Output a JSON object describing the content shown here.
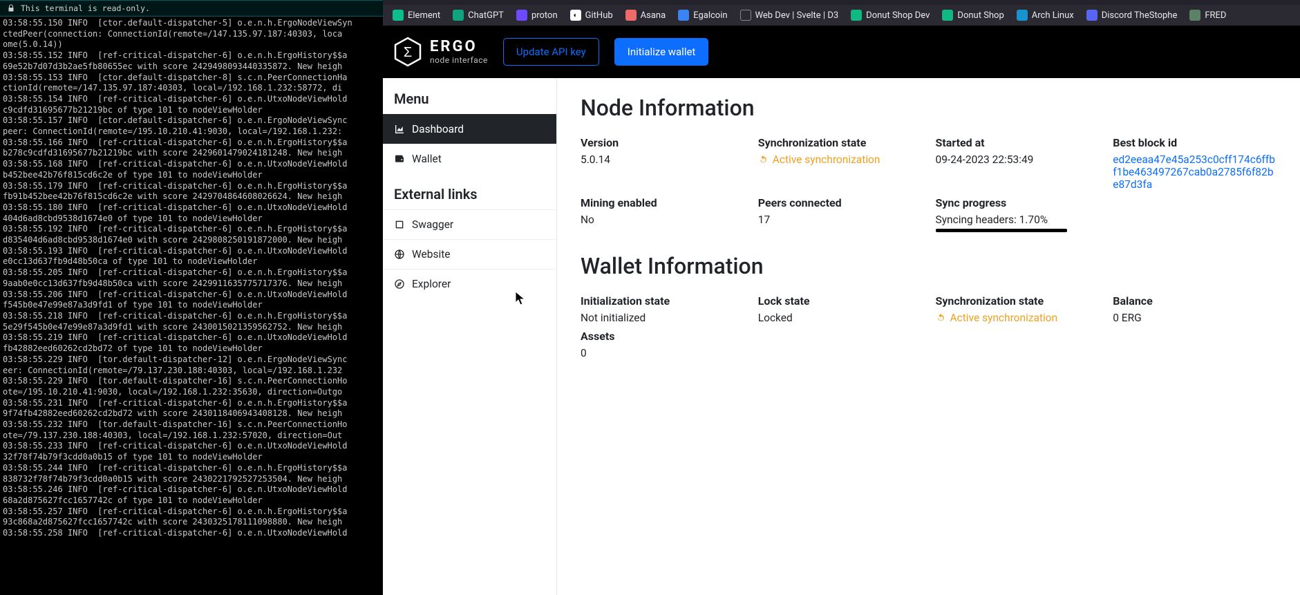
{
  "terminal": {
    "title": "This terminal is read-only.",
    "lines": [
      "03:58:55.150 INFO  [ctor.default-dispatcher-5] o.e.n.h.ErgoNodeViewSyn",
      "ctedPeer(connection: ConnectionId(remote=/147.135.97.187:40303, loca",
      "ome(5.0.14))",
      "03:58:55.152 INFO  [ref-critical-dispatcher-6] o.e.n.h.ErgoHistory$$a",
      "69e52b7d07d3b2ae5fb80655ec with score 2429498093440335872. New heigh",
      "03:58:55.153 INFO  [ctor.default-dispatcher-8] s.c.n.PeerConnectionHa",
      "ctionId(remote=/147.135.97.187:40303, local=/192.168.1.232:58772, di",
      "03:58:55.154 INFO  [ref-critical-dispatcher-6] o.e.n.UtxoNodeViewHold",
      "c9cdfd31695677b21219bc of type 101 to nodeViewHolder",
      "03:58:55.157 INFO  [ctor.default-dispatcher-6] o.e.n.ErgoNodeViewSync",
      "peer: ConnectionId(remote=/195.10.210.41:9030, local=/192.168.1.232:",
      "03:58:55.166 INFO  [ref-critical-dispatcher-6] o.e.n.h.ErgoHistory$$a",
      "b278c9cdfd31695677b21219bc with score 2429601479024181248. New heigh",
      "03:58:55.168 INFO  [ref-critical-dispatcher-6] o.e.n.UtxoNodeViewHold",
      "b452bee42b76f815cd6c2e of type 101 to nodeViewHolder",
      "03:58:55.179 INFO  [ref-critical-dispatcher-6] o.e.n.h.ErgoHistory$$a",
      "fb91b452bee42b76f815cd6c2e with score 2429704864608026624. New heigh",
      "03:58:55.180 INFO  [ref-critical-dispatcher-6] o.e.n.UtxoNodeViewHold",
      "404d6ad8cbd9538d1674e0 of type 101 to nodeViewHolder",
      "03:58:55.192 INFO  [ref-critical-dispatcher-6] o.e.n.h.ErgoHistory$$a",
      "d835404d6ad8cbd9538d1674e0 with score 2429808250191872000. New heigh",
      "03:58:55.193 INFO  [ref-critical-dispatcher-6] o.e.n.UtxoNodeViewHold",
      "e0cc13d637fb9d48b50ca of type 101 to nodeViewHolder",
      "03:58:55.205 INFO  [ref-critical-dispatcher-6] o.e.n.h.ErgoHistory$$a",
      "9aab0e0cc13d637fb9d48b50ca with score 2429911635775717376. New heigh",
      "03:58:55.206 INFO  [ref-critical-dispatcher-6] o.e.n.UtxoNodeViewHold",
      "f545b0e47e99e87a3d9fd1 of type 101 to nodeViewHolder",
      "03:58:55.218 INFO  [ref-critical-dispatcher-6] o.e.n.h.ErgoHistory$$a",
      "5e29f545b0e47e99e87a3d9fd1 with score 2430015021359562752. New heigh",
      "03:58:55.219 INFO  [ref-critical-dispatcher-6] o.e.n.UtxoNodeViewHold",
      "fb42882eed60262cd2bd72 of type 101 to nodeViewHolder",
      "03:58:55.229 INFO  [tor.default-dispatcher-12] o.e.n.ErgoNodeViewSync",
      "eer: ConnectionId(remote=/79.137.230.188:40303, local=/192.168.1.232",
      "03:58:55.229 INFO  [tor.default-dispatcher-16] s.c.n.PeerConnectionHo",
      "ote=/195.10.210.41:9030, local=/192.168.1.232:35630, direction=Outgo",
      "03:58:55.231 INFO  [ref-critical-dispatcher-6] o.e.n.h.ErgoHistory$$a",
      "9f74fb42882eed60262cd2bd72 with score 2430118406943408128. New heigh",
      "03:58:55.232 INFO  [tor.default-dispatcher-16] s.c.n.PeerConnectionHo",
      "ote=/79.137.230.188:40303, local=/192.168.1.232:57020, direction=Out",
      "03:58:55.233 INFO  [ref-critical-dispatcher-6] o.e.n.UtxoNodeViewHold",
      "32f78f74b79f3cdd0a0b15 of type 101 to nodeViewHolder",
      "03:58:55.244 INFO  [ref-critical-dispatcher-6] o.e.n.h.ErgoHistory$$a",
      "838732f78f74b79f3cdd0a0b15 with score 2430221792527253504. New heigh",
      "03:58:55.246 INFO  [ref-critical-dispatcher-6] o.e.n.UtxoNodeViewHold",
      "68a2d875627fcc1657742c of type 101 to nodeViewHolder",
      "03:58:55.257 INFO  [ref-critical-dispatcher-6] o.e.n.h.ErgoHistory$$a",
      "93c868a2d875627fcc1657742c with score 2430325178111098880. New heigh",
      "03:58:55.258 INFO  [ref-critical-dispatcher-6] o.e.n.UtxoNodeViewHold"
    ]
  },
  "bookmarks": [
    {
      "label": "Element",
      "color": "#0dbd8b"
    },
    {
      "label": "ChatGPT",
      "color": "#10a37f"
    },
    {
      "label": "proton",
      "color": "#6d4aff"
    },
    {
      "label": "GitHub",
      "color": "#ffffff"
    },
    {
      "label": "Asana",
      "color": "#f06a6a"
    },
    {
      "label": "Egalcoin",
      "color": "#3b82f6"
    },
    {
      "label": "Web Dev | Svelte | D3",
      "color": "#6b7280"
    },
    {
      "label": "Donut Shop Dev",
      "color": "#10b981"
    },
    {
      "label": "Donut Shop",
      "color": "#10b981"
    },
    {
      "label": "Arch Linux",
      "color": "#1793d1"
    },
    {
      "label": "Discord TheStophe",
      "color": "#5865f2"
    },
    {
      "label": "FRED",
      "color": "#5b8266"
    }
  ],
  "app": {
    "logo_title": "ERGO",
    "logo_sub": "node interface",
    "btn_update": "Update API key",
    "btn_init": "Initialize wallet"
  },
  "sidebar": {
    "menu_title": "Menu",
    "external_title": "External links",
    "menu": [
      {
        "label": "Dashboard",
        "active": true
      },
      {
        "label": "Wallet",
        "active": false
      }
    ],
    "external": [
      {
        "label": "Swagger"
      },
      {
        "label": "Website"
      },
      {
        "label": "Explorer"
      }
    ]
  },
  "node": {
    "heading": "Node Information",
    "fields": {
      "version_l": "Version",
      "version_v": "5.0.14",
      "sync_l": "Synchronization state",
      "sync_v": "Active synchronization",
      "started_l": "Started at",
      "started_v": "09-24-2023 22:53:49",
      "best_l": "Best block id",
      "best_v": "ed2eeaa47e45a253c0cff174c6ffbf1be463497267cab0a2785f6f82be87d3fa",
      "mining_l": "Mining enabled",
      "mining_v": "No",
      "peers_l": "Peers connected",
      "peers_v": "17",
      "prog_l": "Sync progress",
      "prog_v": "Syncing headers: 1.70%"
    }
  },
  "wallet": {
    "heading": "Wallet Information",
    "fields": {
      "init_l": "Initialization state",
      "init_v": "Not initialized",
      "lock_l": "Lock state",
      "lock_v": "Locked",
      "sync_l": "Synchronization state",
      "sync_v": "Active synchronization",
      "bal_l": "Balance",
      "bal_v": "0 ERG",
      "assets_l": "Assets",
      "assets_v": "0"
    }
  }
}
